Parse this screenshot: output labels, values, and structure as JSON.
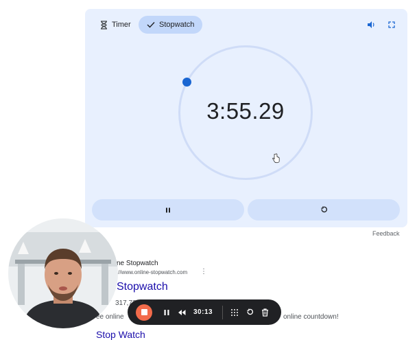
{
  "tabs": {
    "timer_label": "Timer",
    "stopwatch_label": "Stopwatch",
    "active": "stopwatch"
  },
  "stopwatch": {
    "display": "3:55.29"
  },
  "controls": {
    "pause_icon": "pause-icon",
    "reset_icon": "reset-icon"
  },
  "icons": {
    "sound": "volume-icon",
    "fullscreen": "fullscreen-icon"
  },
  "feedback_label": "Feedback",
  "search_result": {
    "site_name": "ne Stopwatch",
    "url": "://www.online-stopwatch.com",
    "title": "Stopwatch",
    "count_text": "317,73",
    "snippet_start": "ee online",
    "snippet_end": "online countdown!",
    "next_title": "Stop Watch"
  },
  "recorder": {
    "elapsed": "30:13"
  },
  "colors": {
    "widget_bg": "#e8f0fe",
    "active_tab": "#c2d7fa",
    "accent": "#1a66d2",
    "record": "#f26b4b",
    "link": "#1a0dab"
  }
}
